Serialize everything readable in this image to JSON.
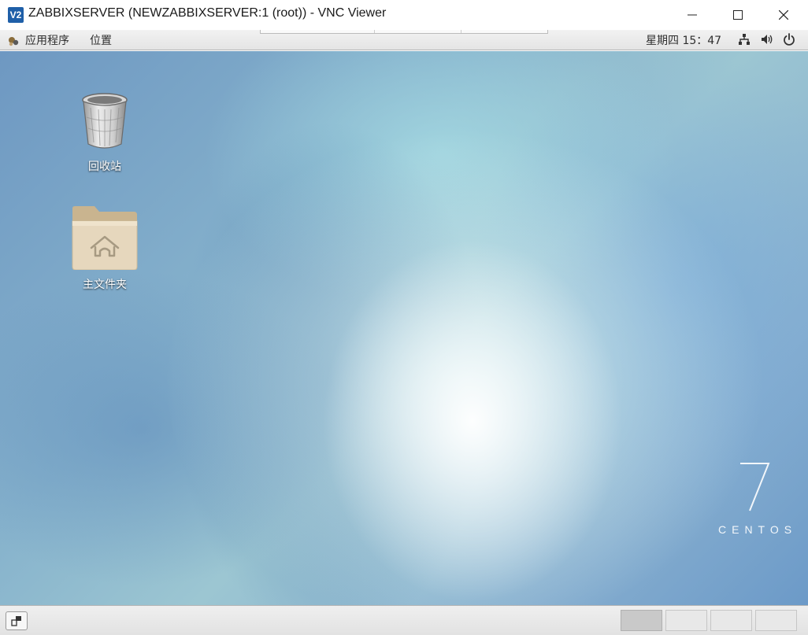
{
  "window": {
    "app_icon_text": "V2",
    "title": "ZABBIXSERVER (NEWZABBIXSERVER:1 (root)) - VNC Viewer"
  },
  "top_panel": {
    "applications_label": "应用程序",
    "places_label": "位置",
    "clock": "星期四 15：47",
    "icons": [
      "network-icon",
      "volume-icon",
      "power-icon"
    ]
  },
  "desktop": {
    "icons": [
      {
        "label": "回收站",
        "icon": "trash-icon"
      },
      {
        "label": "主文件夹",
        "icon": "home-folder-icon"
      }
    ],
    "branding": {
      "number": "7",
      "text": "CENTOS"
    }
  },
  "bottom_panel": {
    "workspaces": 4,
    "active_workspace": 1
  },
  "colors": {
    "folder": "#e6d7bd",
    "titlebar": "#ffffff",
    "panel": "#e8e8e8"
  }
}
